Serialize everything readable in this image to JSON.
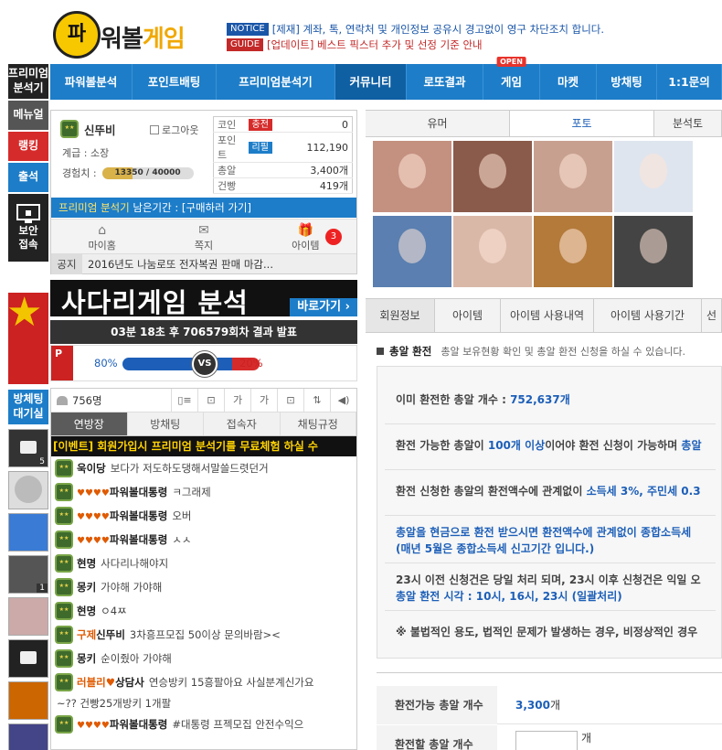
{
  "header": {
    "logo_mark": "파",
    "logo_text_a": "워볼",
    "logo_text_b": "게임",
    "notices": [
      {
        "tag": "NOTICE",
        "text": "[제재] 계좌, 톡, 연락처 및 개인정보 공유시 경고없이 영구 차단조치 합니다."
      },
      {
        "tag": "GUIDE",
        "text": "[업데이트] 베스트 픽스터 추가 및 선정 기준 안내"
      }
    ]
  },
  "leftmenu": {
    "premium": "프리미엄\n분석기",
    "menu": "메뉴얼",
    "rank": "랭킹",
    "attend": "출석",
    "secure": "보안\n접속",
    "bj_live": "방체팅\n대기실"
  },
  "nav": {
    "items": [
      "파워볼분석",
      "포인트배팅",
      "프리미엄분석기",
      "커뮤니티",
      "로또결과",
      "게임",
      "마켓",
      "방채팅",
      "1:1문의"
    ],
    "open_badge": "OPEN"
  },
  "user": {
    "name": "신뚜비",
    "logout": "로그아웃",
    "grade_label": "계급 :",
    "grade": "소장",
    "exp_label": "경험치 :",
    "exp": "13350 / 40000",
    "exp_ratio": 0.33,
    "stats": [
      {
        "k": "코인",
        "tag": "충전",
        "tag_color": "#d62b2b",
        "v": "0"
      },
      {
        "k": "포인트",
        "tag": "리필",
        "tag_color": "#1d7dc8",
        "v": "112,190"
      },
      {
        "k": "총알",
        "tag": "",
        "tag_color": "",
        "v": "3,400개"
      },
      {
        "k": "건빵",
        "tag": "",
        "tag_color": "",
        "v": "419개"
      }
    ],
    "premium_a": "프리미엄 분석기",
    "premium_b": " 남은기간 : [구매하러 가기]",
    "icons": [
      {
        "label": "마이홈"
      },
      {
        "label": "쪽지"
      },
      {
        "label": "아이템"
      }
    ],
    "item_badge": "3",
    "notice_key": "공지",
    "notice_text": "2016년도 나눔로또 전자복권 판매 마감..."
  },
  "ladder": {
    "title": "사다리게임 분석",
    "go": "바로가기 ›",
    "result": "03분 18초 후 706579회차 결과 발표",
    "p": "P",
    "left_pct": "80%",
    "right_pct": "20%",
    "left_ratio": 0.8,
    "vs": "VS"
  },
  "chat": {
    "count": "756명",
    "tools": [
      "▯≡",
      "⊡",
      "가",
      "가",
      "⊡",
      "⇅",
      "◀)"
    ],
    "tabs": [
      "연방장",
      "방채팅",
      "접속자",
      "채팅규정"
    ],
    "event": "[이벤트] 회원가입시 프리미엄 분석기를 무료체험 하실 수",
    "messages": [
      {
        "pre": "",
        "nick": "욱이당",
        "hearts": "",
        "text": "보다가 저도하도댕해서말쓸드렷던거"
      },
      {
        "pre": "",
        "nick": "파워볼대통령",
        "hearts": "♥♥♥♥",
        "text": "ㅋ그래제"
      },
      {
        "pre": "",
        "nick": "파워볼대통령",
        "hearts": "♥♥♥♥",
        "text": "오버"
      },
      {
        "pre": "",
        "nick": "파워볼대통령",
        "hearts": "♥♥♥♥",
        "text": "ㅅㅅ"
      },
      {
        "pre": "",
        "nick": "현명",
        "hearts": "",
        "text": "사다리나해야지"
      },
      {
        "pre": "",
        "nick": "몽키",
        "hearts": "",
        "text": "가야해 가야해"
      },
      {
        "pre": "",
        "nick": "현명",
        "hearts": "",
        "text": "ㅇ4ㅉ"
      },
      {
        "pre": "구제",
        "nick": "신뚜비",
        "hearts": "",
        "text": "3차흥프모집 50이상 문의바람><"
      },
      {
        "pre": "",
        "nick": "몽키",
        "hearts": "",
        "text": "순이줬아 가야해"
      },
      {
        "pre": "러블리♥",
        "nick": "상담사",
        "hearts": "",
        "text": "연승방키 15흥팔아요 사실분계신가요"
      },
      {
        "plain": "~?? 건빵25개방키 1개팔"
      },
      {
        "pre": "",
        "nick": "파워볼대통령",
        "hearts": "♥♥♥♥",
        "text": "#대통령 프젝모집 안전수익으"
      }
    ]
  },
  "sidebadges": [
    "5",
    "",
    "",
    "1",
    "",
    "",
    "",
    ""
  ],
  "right": {
    "tabs": [
      "유머",
      "포토",
      "분석토"
    ],
    "mtabs": [
      "회원정보",
      "아이템",
      "아이템 사용내역",
      "아이템 사용기간",
      "선"
    ],
    "ex_title": "총알 환전",
    "ex_desc": "총알 보유현황 확인 및 총알 환전 신청을 하실 수 있습니다.",
    "info": {
      "l1a": "이미 환전한 총알 개수 : ",
      "l1b": "752,637개",
      "l2a": "환전 가능한 총알이 ",
      "l2b": "100개 이상",
      "l2c": "이어야 환전 신청이 가능하며 ",
      "l2d": "총알",
      "l3a": "환전 신청한 총알의 환전액수에 관계없이 ",
      "l3b": "소득세 3%, 주민세 0.3",
      "l4a": "총알을 현금으로 환전 받으시면 환전액수에 관계없이 종합소득세",
      "l4b": "(매년 5월은 종합소득세 신고기간 입니다.)",
      "l5a": "23시 이전 신청건은 당일 처리 되며, 23시 이후 신청건은 익일 오",
      "l5b": "총알 환전 시각 : 10시, 16시, 23시 (일괄처리)",
      "l6": "※ 불법적인 용도, 법적인 문제가 발생하는 경우, 비정상적인 경우"
    },
    "form": {
      "k1": "환전가능 총알 개수",
      "v1a": "3,300",
      "v1b": "개",
      "k2": "환전할 총알 개수",
      "v2": "개"
    }
  },
  "colors": {
    "nav": "#1d7dc8",
    "red": "#d62b2b",
    "blue": "#1d5fb8"
  }
}
